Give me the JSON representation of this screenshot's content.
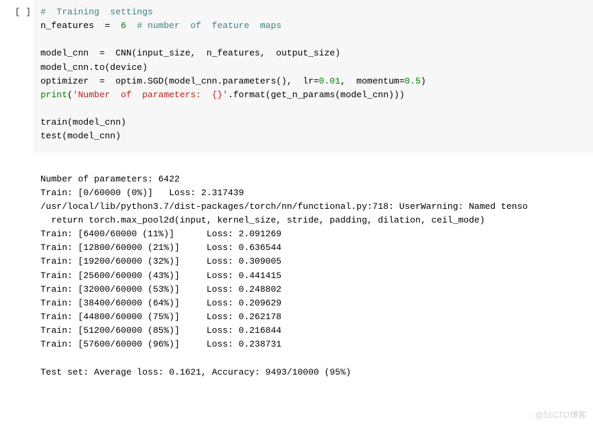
{
  "cell": {
    "prompt": "[ ]",
    "code": {
      "l1_comment": "#  Training  settings",
      "l2_left": "n_features  =  ",
      "l2_val": "6",
      "l2_comment": "  # number  of  feature  maps",
      "l3": "",
      "l4": "model_cnn  =  CNN(input_size,  n_features,  output_size)",
      "l5": "model_cnn.to(device)",
      "l6_a": "optimizer  =  optim.SGD(model_cnn.parameters(),  lr=",
      "l6_lr": "0.01",
      "l6_b": ",  momentum=",
      "l6_m": "0.5",
      "l6_c": ")",
      "l7_print": "print",
      "l7_a": "(",
      "l7_str": "'Number  of  parameters:  {}'",
      "l7_b": ".format(get_n_params(model_cnn)))",
      "l8": "",
      "l9": "train(model_cnn)",
      "l10": "test(model_cnn)"
    }
  },
  "output": {
    "lines": [
      "Number of parameters: 6422",
      "Train: [0/60000 (0%)]   Loss: 2.317439",
      "/usr/local/lib/python3.7/dist-packages/torch/nn/functional.py:718: UserWarning: Named tenso",
      "  return torch.max_pool2d(input, kernel_size, stride, padding, dilation, ceil_mode)",
      "Train: [6400/60000 (11%)]      Loss: 2.091269",
      "Train: [12800/60000 (21%)]     Loss: 0.636544",
      "Train: [19200/60000 (32%)]     Loss: 0.309005",
      "Train: [25600/60000 (43%)]     Loss: 0.441415",
      "Train: [32000/60000 (53%)]     Loss: 0.248802",
      "Train: [38400/60000 (64%)]     Loss: 0.209629",
      "Train: [44800/60000 (75%)]     Loss: 0.262178",
      "Train: [51200/60000 (85%)]     Loss: 0.216844",
      "Train: [57600/60000 (96%)]     Loss: 0.238731",
      "",
      "Test set: Average loss: 0.1621, Accuracy: 9493/10000 (95%)"
    ]
  },
  "watermark": "@51CTO博客"
}
